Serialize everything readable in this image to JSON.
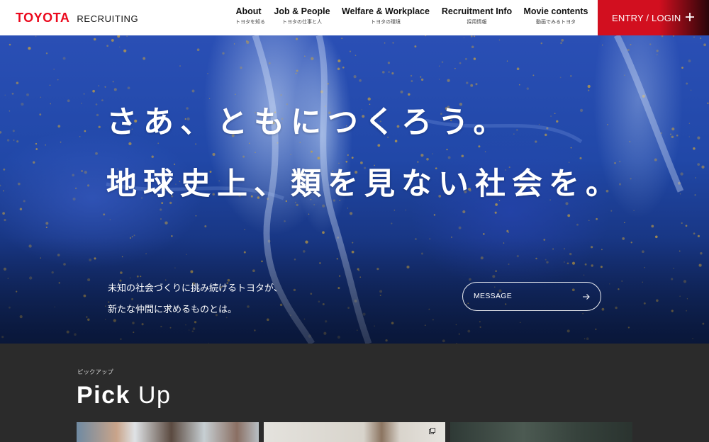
{
  "header": {
    "logo": "TOYOTA",
    "logo_sub": "RECRUITING",
    "nav": [
      {
        "label": "About",
        "sub": "トヨタを知る"
      },
      {
        "label": "Job & People",
        "sub": "トヨタの仕事と人"
      },
      {
        "label": "Welfare & Workplace",
        "sub": "トヨタの環境"
      },
      {
        "label": "Recruitment Info",
        "sub": "採用情報"
      },
      {
        "label": "Movie contents",
        "sub": "動画でみるトヨタ"
      }
    ],
    "entry_label": "ENTRY / LOGIN",
    "entry_icon": "plus-icon"
  },
  "hero": {
    "headline_1": "さあ、ともにつくろう。",
    "headline_2": "地球史上、類を見ない社会を。",
    "sub_1": "未知の社会づくりに挑み続けるトヨタが、",
    "sub_2": "新たな仲間に求めるものとは。",
    "button_label": "MESSAGE",
    "button_icon": "arrow-right-icon"
  },
  "pickup": {
    "label_jp": "ピックアップ",
    "title_bold": "Pick",
    "title_light": "Up"
  },
  "colors": {
    "brand_red": "#eb0a1e",
    "entry_red": "#d20f1f",
    "pickup_bg": "#2b2b2b",
    "hero_blue": "#2148a8",
    "speckle_gold": "#c9a23f"
  }
}
